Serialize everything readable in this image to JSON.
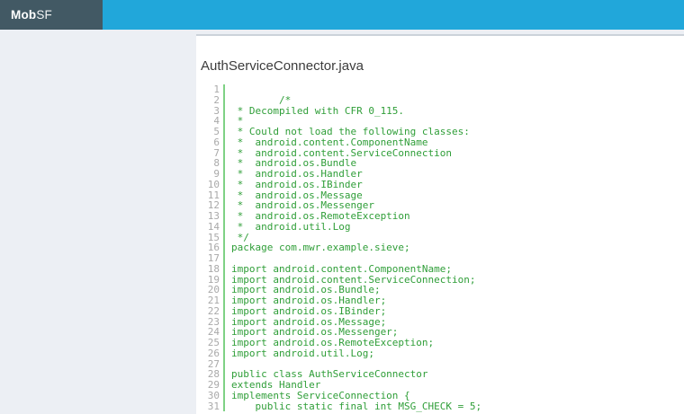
{
  "navbar": {
    "brand_bold": "Mob",
    "brand_rest": "SF"
  },
  "panel": {
    "title": "AuthServiceConnector.java"
  },
  "code": {
    "lines": [
      "",
      "        /*",
      " * Decompiled with CFR 0_115.",
      " *",
      " * Could not load the following classes:",
      " *  android.content.ComponentName",
      " *  android.content.ServiceConnection",
      " *  android.os.Bundle",
      " *  android.os.Handler",
      " *  android.os.IBinder",
      " *  android.os.Message",
      " *  android.os.Messenger",
      " *  android.os.RemoteException",
      " *  android.util.Log",
      " */",
      "package com.mwr.example.sieve;",
      "",
      "import android.content.ComponentName;",
      "import android.content.ServiceConnection;",
      "import android.os.Bundle;",
      "import android.os.Handler;",
      "import android.os.IBinder;",
      "import android.os.Message;",
      "import android.os.Messenger;",
      "import android.os.RemoteException;",
      "import android.util.Log;",
      "",
      "public class AuthServiceConnector",
      "extends Handler",
      "implements ServiceConnection {",
      "    public static final int MSG_CHECK = 5;"
    ]
  },
  "colors": {
    "navbar_dark": "#42596 4",
    "navbar_accent": "#21a7da",
    "page_bg": "#eceff4",
    "panel_border": "#ccd2da",
    "title_color": "#3c3c3c",
    "code_green": "#2f9e38",
    "gutter_green": "#7ed184",
    "line_number_gray": "#a9a9a9"
  }
}
